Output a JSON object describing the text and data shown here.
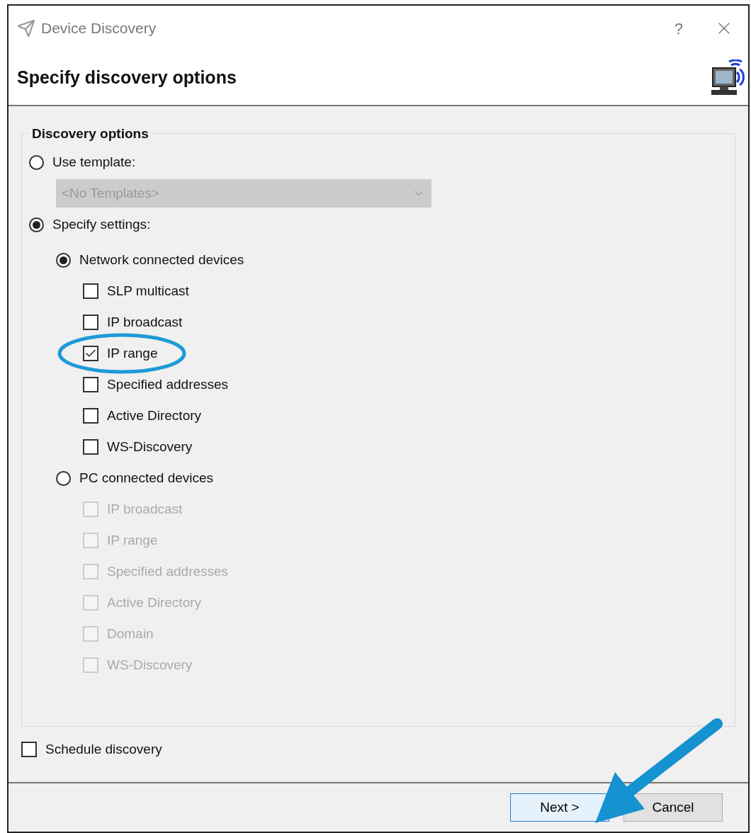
{
  "window": {
    "title": "Device Discovery",
    "help": "?"
  },
  "header": {
    "title": "Specify discovery options"
  },
  "group": {
    "title": "Discovery options",
    "modes": [
      {
        "label": "Use template:",
        "selected": false,
        "dropdown": {
          "value": "<No Templates>",
          "disabled": true
        }
      },
      {
        "label": "Specify settings:",
        "selected": true,
        "sources": [
          {
            "label": "Network connected devices",
            "selected": true,
            "methods": [
              {
                "label": "SLP multicast",
                "checked": false,
                "disabled": false
              },
              {
                "label": "IP broadcast",
                "checked": false,
                "disabled": false
              },
              {
                "label": "IP range",
                "checked": true,
                "disabled": false
              },
              {
                "label": "Specified addresses",
                "checked": false,
                "disabled": false
              },
              {
                "label": "Active Directory",
                "checked": false,
                "disabled": false
              },
              {
                "label": "WS-Discovery",
                "checked": false,
                "disabled": false
              }
            ]
          },
          {
            "label": "PC connected devices",
            "selected": false,
            "methods": [
              {
                "label": "IP broadcast",
                "checked": false,
                "disabled": true
              },
              {
                "label": "IP range",
                "checked": false,
                "disabled": true
              },
              {
                "label": "Specified addresses",
                "checked": false,
                "disabled": true
              },
              {
                "label": "Active Directory",
                "checked": false,
                "disabled": true
              },
              {
                "label": "Domain",
                "checked": false,
                "disabled": true
              },
              {
                "label": "WS-Discovery",
                "checked": false,
                "disabled": true
              }
            ]
          }
        ]
      }
    ]
  },
  "schedule": {
    "label": "Schedule discovery",
    "checked": false
  },
  "buttons": [
    {
      "label": "Next >",
      "default": true
    },
    {
      "label": "Cancel",
      "default": false
    }
  ]
}
